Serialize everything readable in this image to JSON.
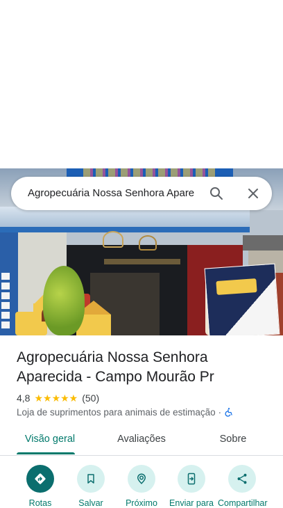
{
  "search": {
    "query": "Agropecuária Nossa Senhora Apare"
  },
  "place": {
    "title": "Agropecuária Nossa Senhora Aparecida - Campo Mourão Pr",
    "rating": "4,8",
    "stars": "★★★★★",
    "review_count": "(50)",
    "category": "Loja de suprimentos para animais de estimação",
    "separator": "·"
  },
  "tabs": [
    {
      "label": "Visão geral",
      "active": true
    },
    {
      "label": "Avaliações",
      "active": false
    },
    {
      "label": "Sobre",
      "active": false
    }
  ],
  "actions": [
    {
      "label": "Rotas",
      "icon": "directions-icon"
    },
    {
      "label": "Salvar",
      "icon": "bookmark-icon"
    },
    {
      "label": "Próximo",
      "icon": "nearby-icon"
    },
    {
      "label": "Enviar para",
      "icon": "send-to-phone-icon"
    },
    {
      "label": "Compartilhar",
      "icon": "share-icon"
    }
  ],
  "colors": {
    "accent": "#00796b",
    "primary_button": "#0b6e6e",
    "secondary_button": "#d6f1ef",
    "star": "#fbbc04"
  }
}
